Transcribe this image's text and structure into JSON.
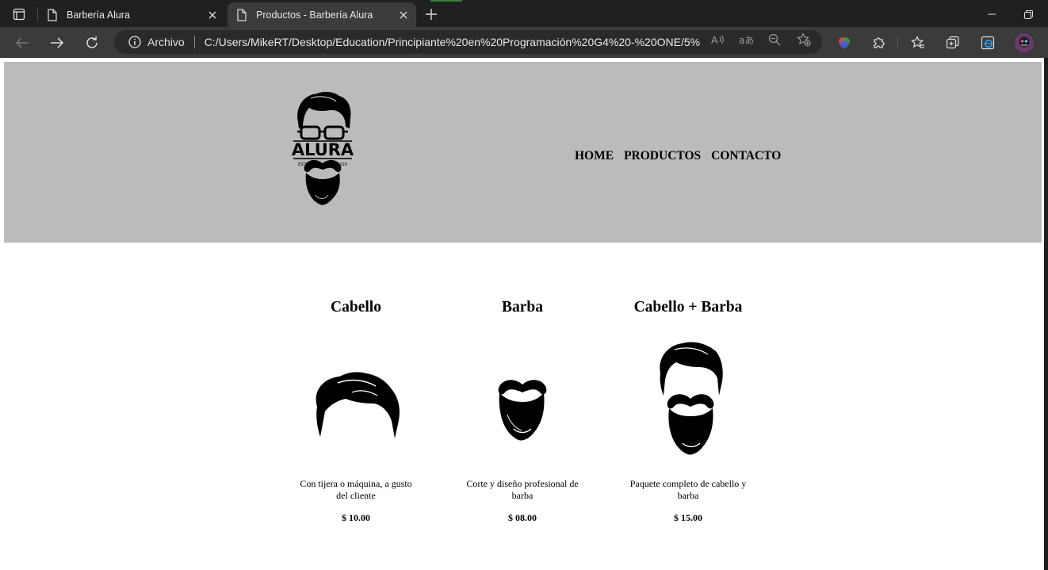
{
  "browser": {
    "tabs": [
      {
        "title": "Barbería Alura",
        "active": false
      },
      {
        "title": "Productos - Barbería Alura",
        "active": true
      }
    ],
    "address": {
      "site_label": "Archivo",
      "url": "C:/Users/MikeRT/Desktop/Education/Principiante%20en%20Programación%20G4%20-%20ONE/5%..."
    },
    "accent_color": "#3b3b3b"
  },
  "site": {
    "header_bg": "#bbbbbb",
    "logo_text": "ALURA",
    "logo_estd": "ESTD",
    "logo_year": "2020",
    "nav": [
      "HOME",
      "PRODUCTOS",
      "CONTACTO"
    ]
  },
  "products": [
    {
      "title": "Cabello",
      "icon": "hair-icon",
      "description": "Con tijera o máquina, a gusto del cliente",
      "price": "$ 10.00"
    },
    {
      "title": "Barba",
      "icon": "beard-icon",
      "description": "Corte y diseño profesional de barba",
      "price": "$ 08.00"
    },
    {
      "title": "Cabello + Barba",
      "icon": "hair-beard-icon",
      "description": "Paquete completo de cabello y barba",
      "price": "$ 15.00"
    }
  ]
}
